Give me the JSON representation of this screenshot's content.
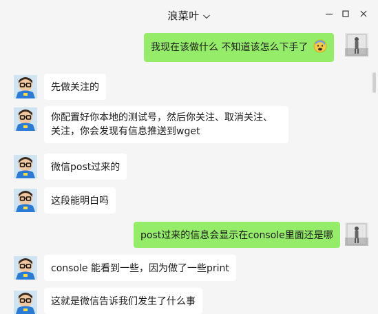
{
  "header": {
    "title": "浪菜叶"
  },
  "icons": {
    "dropdown": "chevron-down-icon",
    "minimize": "minimize-icon",
    "maximize": "maximize-icon",
    "close": "close-icon"
  },
  "colors": {
    "background": "#f5f5f5",
    "incoming_bubble": "#ffffff",
    "outgoing_bubble": "#95ec69"
  },
  "messages": [
    {
      "side": "right",
      "text": "我现在该做什么  不知道该怎么下手了",
      "emoji": "anxious-face-with-sweat"
    },
    {
      "side": "left",
      "text": "先做关注的"
    },
    {
      "side": "left",
      "text": "你配置好你本地的测试号，然后你关注、取消关注、关注，你会发现有信息推送到wget"
    },
    {
      "side": "left",
      "text": "微信post过来的"
    },
    {
      "side": "left",
      "text": "这段能明白吗"
    },
    {
      "side": "right",
      "text": "post过来的信息会显示在console里面还是哪"
    },
    {
      "side": "left",
      "text": "console 能看到一些，因为做了一些print"
    },
    {
      "side": "left",
      "text": "这就是微信告诉我们发生了什么事"
    }
  ]
}
